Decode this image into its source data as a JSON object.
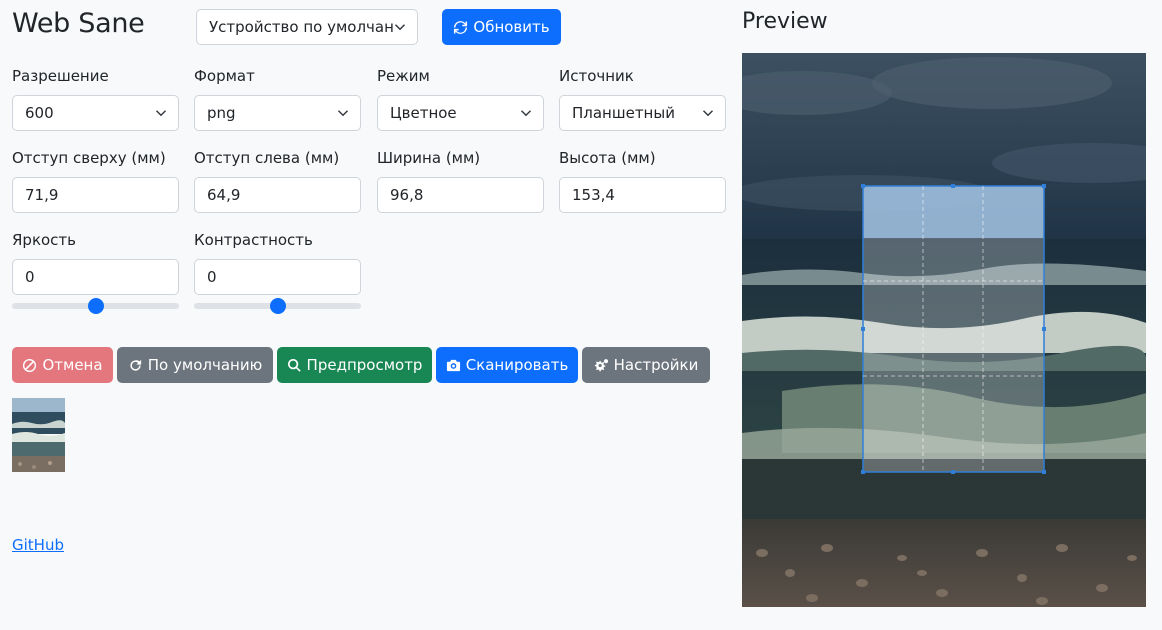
{
  "header": {
    "title": "Web Sane",
    "device_select": "Устройство по умолчан",
    "refresh_label": "Обновить"
  },
  "settings": {
    "resolution": {
      "label": "Разрешение",
      "value": "600"
    },
    "format": {
      "label": "Формат",
      "value": "png"
    },
    "mode": {
      "label": "Режим",
      "value": "Цветное"
    },
    "source": {
      "label": "Источник",
      "value": "Планшетный"
    },
    "top": {
      "label": "Отступ сверху (мм)",
      "value": "71,9"
    },
    "left": {
      "label": "Отступ слева (мм)",
      "value": "64,9"
    },
    "width": {
      "label": "Ширина (мм)",
      "value": "96,8"
    },
    "height": {
      "label": "Высота (мм)",
      "value": "153,4"
    },
    "brightness": {
      "label": "Яркость",
      "value": "0",
      "slider_fraction": 0.5
    },
    "contrast": {
      "label": "Контрастность",
      "value": "0",
      "slider_fraction": 0.5
    }
  },
  "actions": {
    "cancel": "Отмена",
    "reset": "По умолчанию",
    "preview": "Предпросмотр",
    "scan": "Сканировать",
    "settings": "Настройки"
  },
  "footer": {
    "github": "GitHub"
  },
  "preview": {
    "title": "Preview"
  },
  "colors": {
    "primary": "#0d6efd",
    "danger_disabled": "#e4777e",
    "secondary": "#6c757d",
    "success": "#198754"
  }
}
